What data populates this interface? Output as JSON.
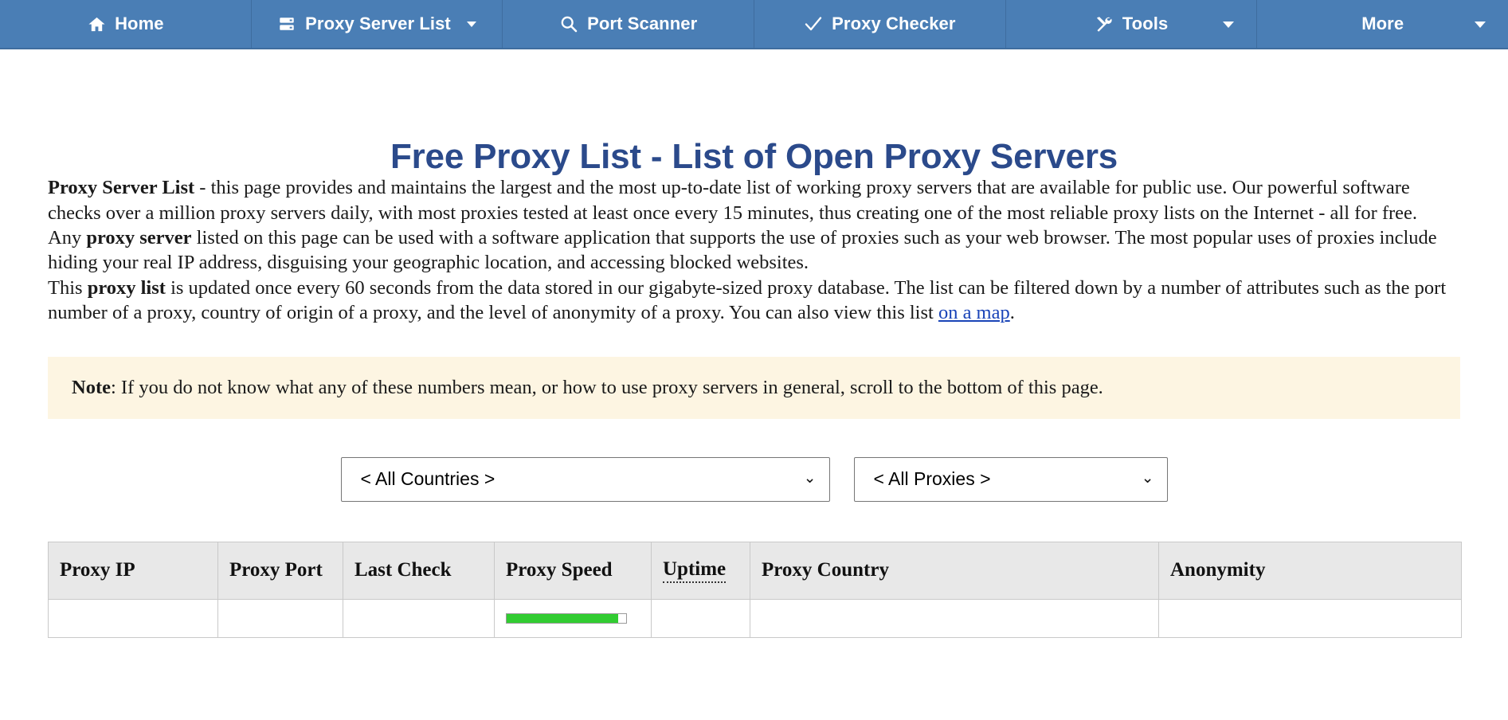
{
  "nav": {
    "items": [
      {
        "label": "Home",
        "icon": "home-icon",
        "caret": "none"
      },
      {
        "label": "Proxy Server List",
        "icon": "server-icon",
        "caret": "inline"
      },
      {
        "label": "Port Scanner",
        "icon": "search-icon",
        "caret": "none"
      },
      {
        "label": "Proxy Checker",
        "icon": "check-icon",
        "caret": "none"
      },
      {
        "label": "Tools",
        "icon": "tools-icon",
        "caret": "right"
      },
      {
        "label": "More",
        "icon": "none",
        "caret": "right"
      }
    ]
  },
  "page": {
    "title": "Free Proxy List - List of Open Proxy Servers",
    "paragraphs": {
      "p1_bold": "Proxy Server List",
      "p1_text": " - this page provides and maintains the largest and the most up-to-date list of working proxy servers that are available for public use. Our powerful software checks over a million proxy servers daily, with most proxies tested at least once every 15 minutes, thus creating one of the most reliable proxy lists on the Internet - all for free.",
      "p2_pre": "Any ",
      "p2_bold": "proxy server",
      "p2_text": " listed on this page can be used with a software application that supports the use of proxies such as your web browser. The most popular uses of proxies include hiding your real IP address, disguising your geographic location, and accessing blocked websites.",
      "p3_pre": "This ",
      "p3_bold": "proxy list",
      "p3_mid": " is updated once every 60 seconds from the data stored in our gigabyte-sized proxy database. The list can be filtered down by a number of attributes such as the port number of a proxy, country of origin of a proxy, and the level of anonymity of a proxy. You can also view this list ",
      "p3_link": "on a map",
      "p3_end": "."
    },
    "note": {
      "bold": "Note",
      "text": ": If you do not know what any of these numbers mean, or how to use proxy servers in general, scroll to the bottom of this page."
    }
  },
  "filters": {
    "country": {
      "selected": "< All Countries >",
      "options": [
        "< All Countries >"
      ]
    },
    "proxy": {
      "selected": "< All Proxies >",
      "options": [
        "< All Proxies >"
      ]
    },
    "caret_glyph": "⌄"
  },
  "table": {
    "headers": [
      {
        "label": "Proxy IP",
        "dotted": false
      },
      {
        "label": "Proxy Port",
        "dotted": false
      },
      {
        "label": "Last Check",
        "dotted": false
      },
      {
        "label": "Proxy Speed",
        "dotted": false
      },
      {
        "label": "Uptime",
        "dotted": true
      },
      {
        "label": "Proxy Country",
        "dotted": false
      },
      {
        "label": "Anonymity",
        "dotted": false
      }
    ],
    "rows": [
      {
        "ip": "",
        "port": "",
        "last_check": "",
        "speed_percent": 93,
        "uptime": "",
        "country": "",
        "anonymity": ""
      }
    ]
  },
  "colors": {
    "nav_background": "#4a7eb5",
    "title": "#2b4a8b",
    "link": "#1a44b8",
    "note_background": "#fdf5e2",
    "table_header_background": "#e8e8e8",
    "speed_bar": "#31cc31"
  }
}
